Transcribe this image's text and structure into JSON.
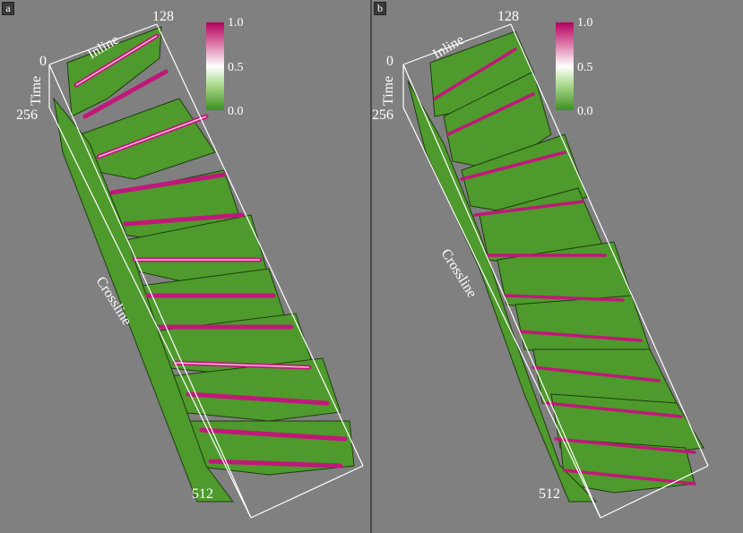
{
  "panels": [
    {
      "tag": "a",
      "axes": {
        "inline_label": "Inline",
        "time_label": "Time",
        "crossline_label": "Crossline",
        "inline_max": "128",
        "origin": "0",
        "time_max": "256",
        "crossline_max": "512"
      },
      "colorbar": {
        "max": "1.0",
        "mid": "0.5",
        "min": "0.0"
      }
    },
    {
      "tag": "b",
      "axes": {
        "inline_label": "Inline",
        "time_label": "Time",
        "crossline_label": "Crossline",
        "inline_max": "128",
        "origin": "0",
        "time_max": "256",
        "crossline_max": "512"
      },
      "colorbar": {
        "max": "1.0",
        "mid": "0.5",
        "min": "0.0"
      }
    }
  ],
  "colors": {
    "background": "#808080",
    "green": "#4e9a2c",
    "magenta": "#c0187a",
    "white": "#ffffff"
  }
}
